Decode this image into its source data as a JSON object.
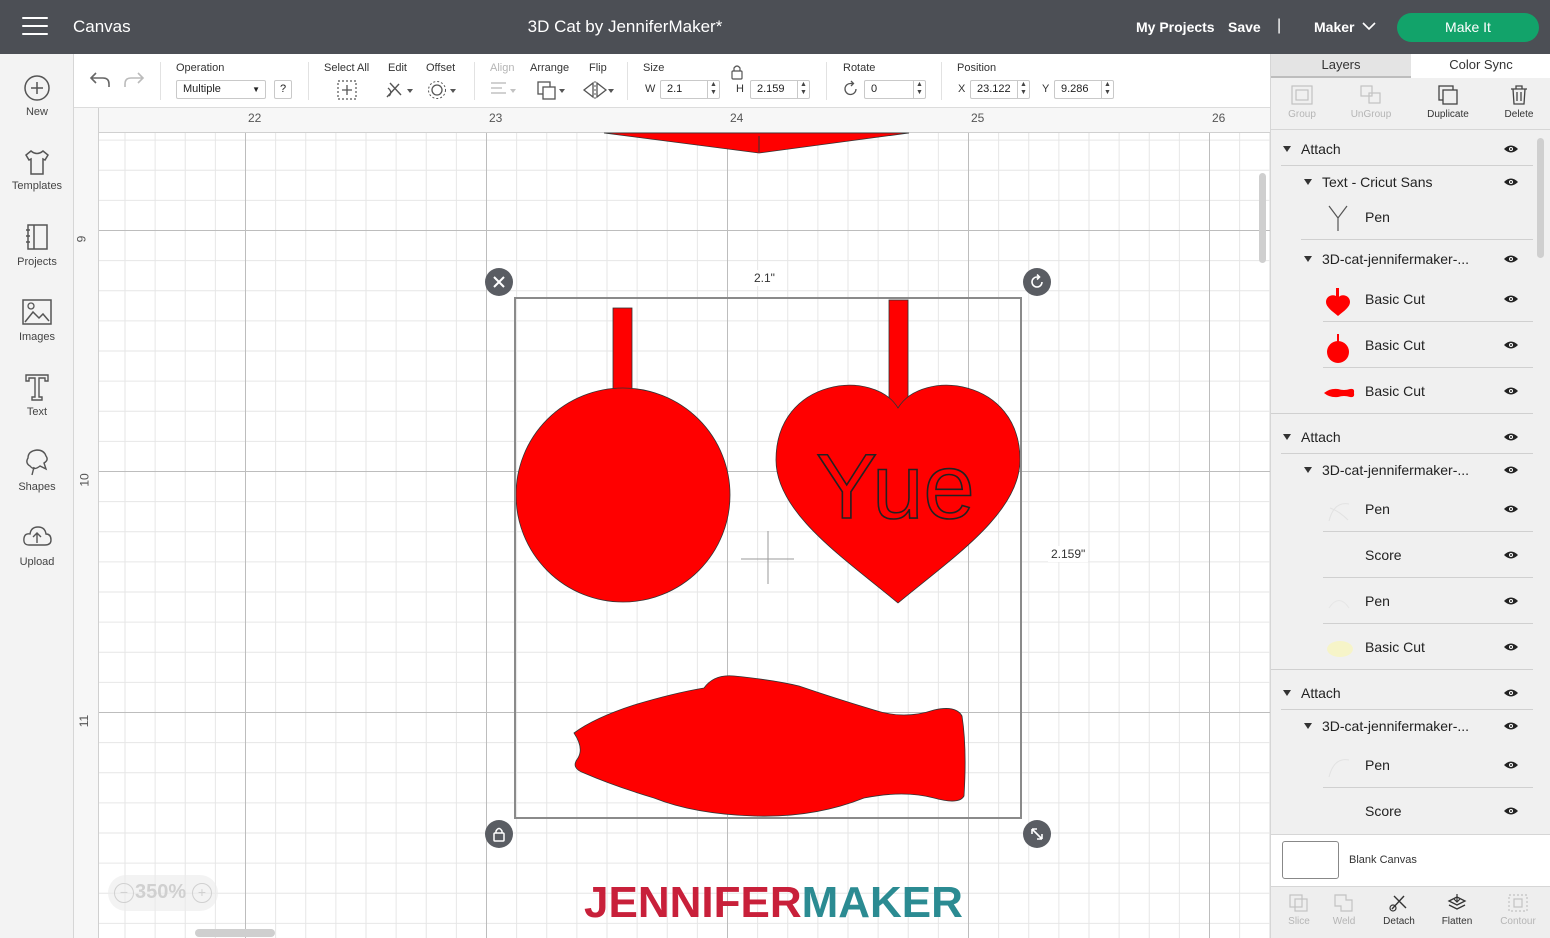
{
  "topbar": {
    "app_title": "Canvas",
    "project_title": "3D Cat by JenniferMaker*",
    "my_projects": "My Projects",
    "save": "Save",
    "separator": "|",
    "machine": "Maker",
    "make_it": "Make It",
    "make_it_color": "#12a36a"
  },
  "leftbar": {
    "items": [
      {
        "label": "New",
        "icon": "plus-circle-icon"
      },
      {
        "label": "Templates",
        "icon": "shirt-icon"
      },
      {
        "label": "Projects",
        "icon": "notebook-icon"
      },
      {
        "label": "Images",
        "icon": "image-icon"
      },
      {
        "label": "Text",
        "icon": "text-t-icon"
      },
      {
        "label": "Shapes",
        "icon": "shapes-icon"
      },
      {
        "label": "Upload",
        "icon": "cloud-upload-icon"
      }
    ]
  },
  "toolbar": {
    "operation_label": "Operation",
    "operation_value": "Multiple",
    "help": "?",
    "select_all": "Select All",
    "edit": "Edit",
    "offset": "Offset",
    "align": "Align",
    "arrange": "Arrange",
    "flip": "Flip",
    "size": "Size",
    "w_label": "W",
    "w_value": "2.1",
    "h_label": "H",
    "h_value": "2.159",
    "rotate": "Rotate",
    "rotate_value": "0",
    "position": "Position",
    "x_label": "X",
    "x_value": "23.122",
    "y_label": "Y",
    "y_value": "9.286"
  },
  "canvas": {
    "ruler_top": [
      "22",
      "23",
      "24",
      "25",
      "26"
    ],
    "ruler_left": [
      "9",
      "10",
      "11"
    ],
    "width_label": "2.1\"",
    "height_label": "2.159\"",
    "heart_text": "Yue",
    "shape_color": "#ff0000",
    "zoom": "350%",
    "zoom_minus": "−",
    "zoom_plus": "+",
    "watermark_a": "JENNIFER",
    "watermark_b": "MAKER"
  },
  "rightpanel": {
    "tabs": [
      "Layers",
      "Color Sync"
    ],
    "actions": [
      {
        "label": "Group",
        "enabled": false
      },
      {
        "label": "UnGroup",
        "enabled": false
      },
      {
        "label": "Duplicate",
        "enabled": true
      },
      {
        "label": "Delete",
        "enabled": true
      }
    ],
    "layers": [
      {
        "label": "Attach",
        "level": 0
      },
      {
        "label": "Text - Cricut Sans",
        "level": 1
      },
      {
        "label": "Pen",
        "level": 2,
        "thumb": "y-letter"
      },
      {
        "label": "3D-cat-jennifermaker-...",
        "level": 1
      },
      {
        "label": "Basic Cut",
        "level": 2,
        "thumb": "red-heart"
      },
      {
        "label": "Basic Cut",
        "level": 2,
        "thumb": "red-circle"
      },
      {
        "label": "Basic Cut",
        "level": 2,
        "thumb": "red-fish"
      },
      {
        "label": "Attach",
        "level": 0
      },
      {
        "label": "3D-cat-jennifermaker-...",
        "level": 1
      },
      {
        "label": "Pen",
        "level": 2,
        "thumb": "faint"
      },
      {
        "label": "Score",
        "level": 2,
        "thumb": "none"
      },
      {
        "label": "Pen",
        "level": 2,
        "thumb": "faint"
      },
      {
        "label": "Basic Cut",
        "level": 2,
        "thumb": "faint-yellow"
      },
      {
        "label": "Attach",
        "level": 0
      },
      {
        "label": "3D-cat-jennifermaker-...",
        "level": 1
      },
      {
        "label": "Pen",
        "level": 2,
        "thumb": "faint"
      },
      {
        "label": "Score",
        "level": 2,
        "thumb": "none"
      }
    ],
    "blank_canvas": "Blank Canvas",
    "bottom": [
      {
        "label": "Slice",
        "enabled": false
      },
      {
        "label": "Weld",
        "enabled": false
      },
      {
        "label": "Detach",
        "enabled": true
      },
      {
        "label": "Flatten",
        "enabled": true
      },
      {
        "label": "Contour",
        "enabled": false
      }
    ]
  }
}
